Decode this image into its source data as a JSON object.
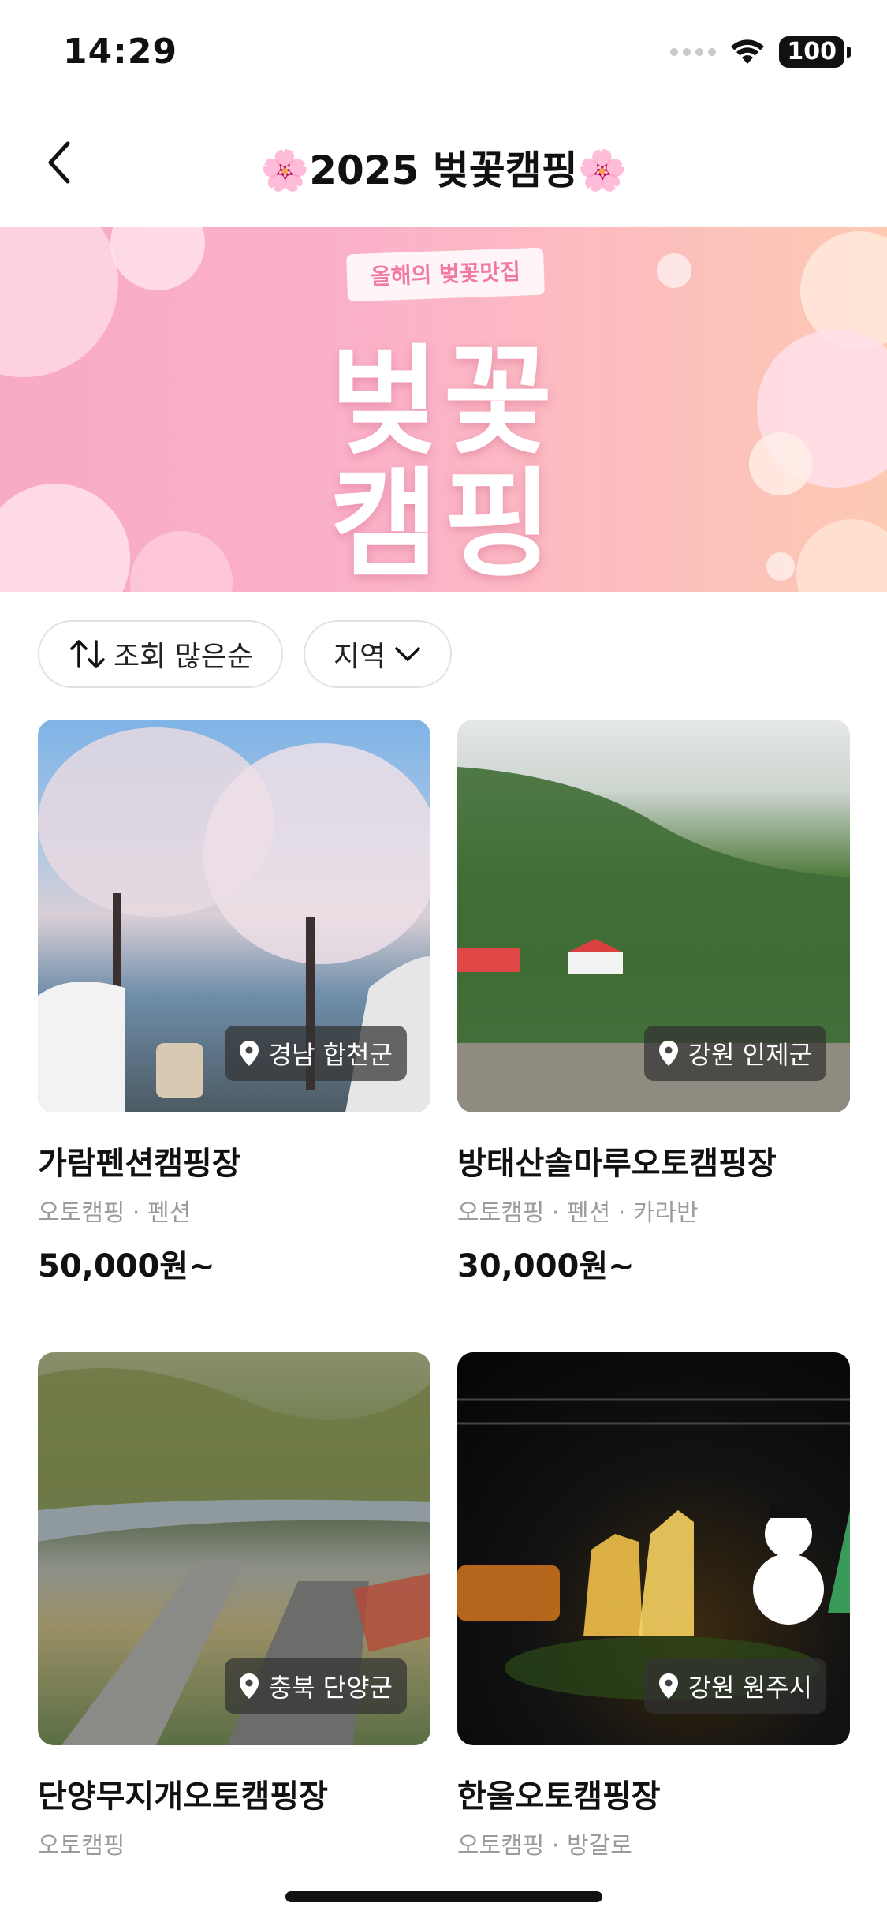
{
  "status_bar": {
    "time": "14:29",
    "battery": "100"
  },
  "nav": {
    "title": "🌸2025 벚꽃캠핑🌸"
  },
  "banner": {
    "ribbon": "올해의 벚꽃맛집",
    "line1": "벚꽃",
    "line2": "캠핑"
  },
  "filters": {
    "sort_label": "조회 많은순",
    "region_label": "지역"
  },
  "cards": [
    {
      "name": "가람펜션캠핑장",
      "tags": "오토캠핑 · 펜션",
      "price": "50,000원~",
      "region": "경남 합천군"
    },
    {
      "name": "방태산솔마루오토캠핑장",
      "tags": "오토캠핑 · 펜션 · 카라반",
      "price": "30,000원~",
      "region": "강원 인제군"
    },
    {
      "name": "단양무지개오토캠핑장",
      "tags": "오토캠핑",
      "price": "",
      "region": "충북 단양군"
    },
    {
      "name": "한울오토캠핑장",
      "tags": "오토캠핑 · 방갈로",
      "price": "",
      "region": "강원 원주시"
    }
  ],
  "icons": {
    "back": "chevron-left-icon",
    "sort": "sort-arrows-icon",
    "dropdown": "chevron-down-icon",
    "location": "location-pin-icon",
    "wifi": "wifi-icon",
    "battery": "battery-icon",
    "signal": "signal-dots-icon"
  },
  "colors": {
    "banner_start": "#f8a9c6",
    "banner_end": "#fdc9b3",
    "badge_bg": "#323232",
    "tag_text": "#9b9b9b"
  }
}
